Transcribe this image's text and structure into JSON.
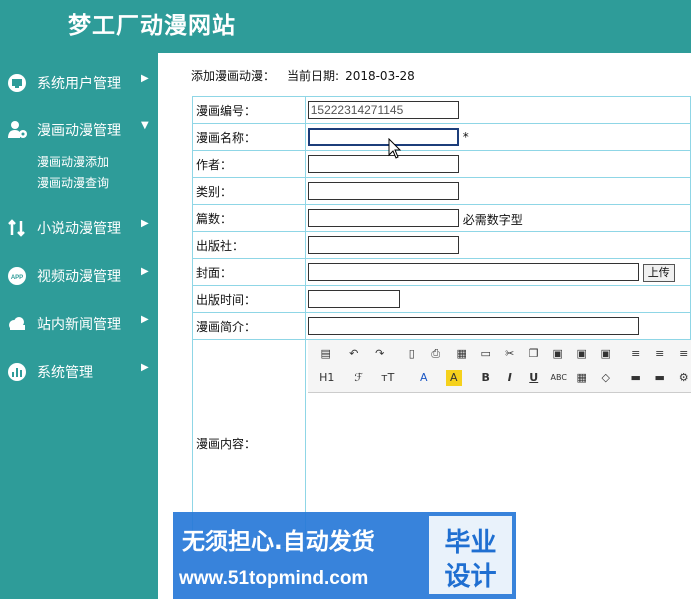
{
  "header": {
    "title": "梦工厂动漫网站"
  },
  "sidebar": {
    "items": [
      {
        "label": "系统用户管理",
        "icon": "monitor-icon"
      },
      {
        "label": "漫画动漫管理",
        "icon": "user-gear-icon",
        "expanded": true,
        "sub": [
          {
            "label": "漫画动漫添加"
          },
          {
            "label": "漫画动漫查询"
          }
        ]
      },
      {
        "label": "小说动漫管理",
        "icon": "transfer-icon"
      },
      {
        "label": "视频动漫管理",
        "icon": "app-icon"
      },
      {
        "label": "站内新闻管理",
        "icon": "cloud-icon"
      },
      {
        "label": "系统管理",
        "icon": "chart-icon"
      }
    ]
  },
  "main": {
    "heading": "添加漫画动漫：",
    "date_label": "当前日期:",
    "date_value": "2018-03-28"
  },
  "form": {
    "code_label": "漫画编号：",
    "code_value": "15222314271145",
    "name_label": "漫画名称：",
    "name_required": "*",
    "author_label": "作者：",
    "category_label": "类别：",
    "episodes_label": "篇数：",
    "episodes_note": "必需数字型",
    "publisher_label": "出版社：",
    "cover_label": "封面：",
    "upload_label": "上传",
    "pubtime_label": "出版时间：",
    "intro_label": "漫画简介：",
    "content_label": "漫画内容："
  },
  "editor_toolbar": {
    "heading": "H1",
    "font": "ℱ",
    "size": "тT",
    "fontcolor": "A",
    "bgcolor": "A",
    "bold": "B",
    "italic": "I",
    "underline": "U",
    "strike": "ABC"
  },
  "watermark": {
    "line1": "无须担心.自动发货",
    "line2": "www.51topmind.com",
    "box_line1": "毕业",
    "box_line2": "设计"
  }
}
